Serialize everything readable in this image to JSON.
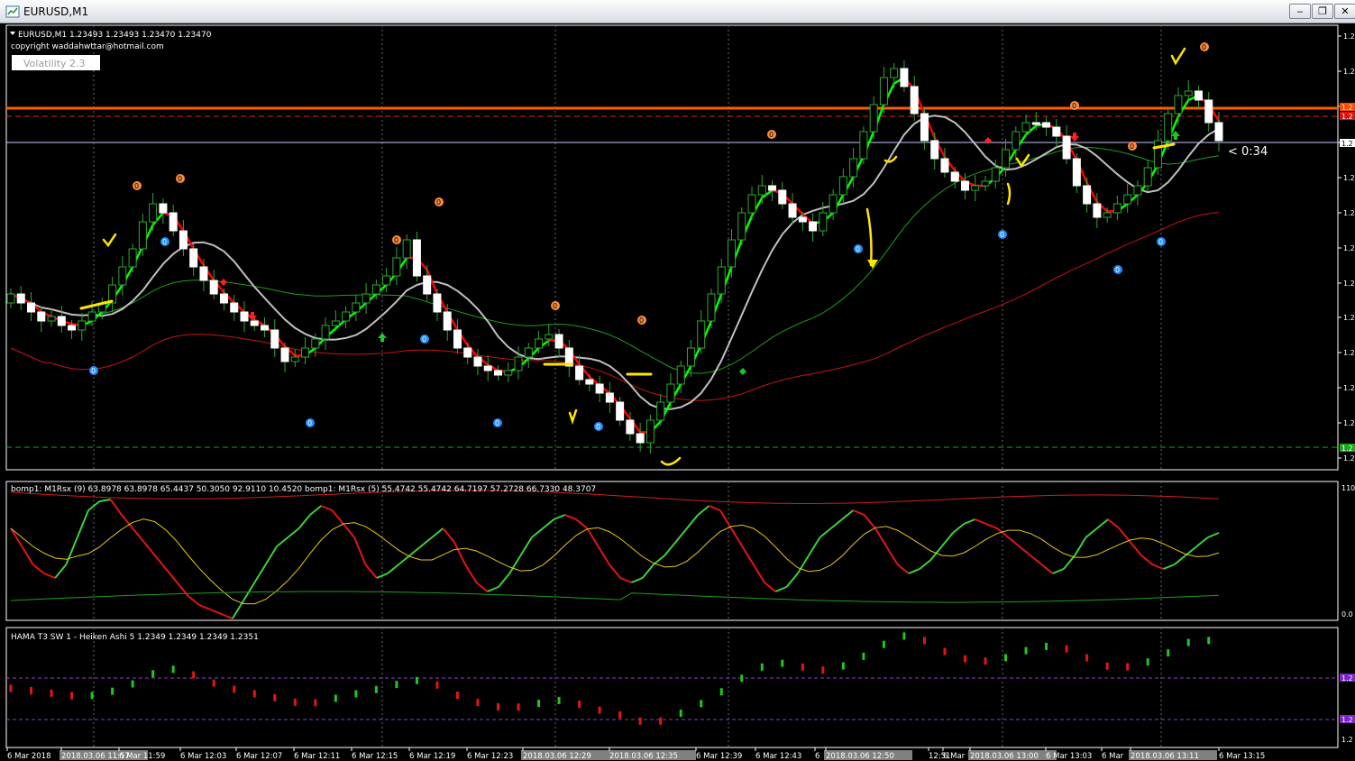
{
  "window": {
    "title": "EURUSD,M1",
    "minimize": "‒",
    "restore": "❐",
    "close": "✕"
  },
  "main": {
    "header": "EURUSD,M1  1.23493 1.23493 1.23470 1.23470",
    "copyright": "copyright waddahwttar@hotmail.com",
    "volatility": "Volatility 2.3",
    "countdown": "< 0:34",
    "yaxis": [
      "1.2",
      "1.2",
      "1.2",
      "1.2",
      "1.2",
      "1.2",
      "1.2",
      "1.2",
      "1.2",
      "1.2",
      "1.2",
      "1.2",
      "1.2"
    ],
    "tag_red1": "1.2",
    "tag_red2": "1.2",
    "tag_white": "1.2",
    "tag_green": "1.2",
    "signal_label": "0"
  },
  "sub1": {
    "header": "bomp1: M1Rsx (9) 63.8978 63.8978 65.4437 50.3050 92.9110 10.4520  bomp1: M1Rsx (5) 55.4742 55.4742 64.7197 57.2728 66.7330 48.3707",
    "y_top": "110",
    "y_bottom": "0.0"
  },
  "sub2": {
    "header": "HAMA T3 SW 1 -  Heiken Ashi 5 1.2349 1.2349 1.2349 1.2351",
    "tag1": "1.2",
    "tag2": "1.2",
    "y_bottom": "1.2"
  },
  "timeaxis": [
    "6 Mar 2018",
    "2018.03.06 11:57",
    "6 Mar 11:59",
    "6 Mar 12:03",
    "6 Mar 12:07",
    "6 Mar 12:11",
    "6 Mar 12:15",
    "6 Mar 12:19",
    "6 Mar 12:23",
    "2018.03.06 12:29",
    "2018.03.06 12:35",
    "6 Mar 12:39",
    "6 Mar 12:43",
    "6",
    "2018.03.06 12:50",
    "12:51",
    "6 Mar 12:",
    "2018.03.06 13:00",
    "6 Mar 13:03",
    "6 Mar",
    "2018.03.06 13:11",
    "6 Mar 13:15"
  ],
  "chart_data": {
    "type": "candlestick",
    "symbol": "EURUSD",
    "timeframe": "M1",
    "last_bar_ohlc": [
      1.23493,
      1.23493,
      1.2347,
      1.2347
    ],
    "volatility": 2.3,
    "indicators": [
      {
        "name": "bomp1: M1Rsx (9)",
        "values": [
          63.8978,
          63.8978,
          65.4437,
          50.305,
          92.911,
          10.452
        ]
      },
      {
        "name": "bomp1: M1Rsx (5)",
        "values": [
          55.4742,
          55.4742,
          64.7197,
          57.2728,
          66.733,
          48.3707
        ]
      },
      {
        "name": "HAMA T3 SW 1 -  Heiken Ashi 5",
        "values": [
          1.2349,
          1.2349,
          1.2349,
          1.2351
        ]
      }
    ]
  },
  "colors": {
    "bull": "#ffffff",
    "bear": "#ffffff",
    "ma_fast_up": "#00ff00",
    "ma_fast_down": "#ff0000",
    "ma_gray": "#c0c0c0",
    "ma_green": "#1e9e1e",
    "ma_red": "#c81414",
    "level_orange": "#ff5a00",
    "signal_orange": "#ff8c3c",
    "signal_blue": "#1e90ff",
    "annotation": "#ffe600"
  }
}
